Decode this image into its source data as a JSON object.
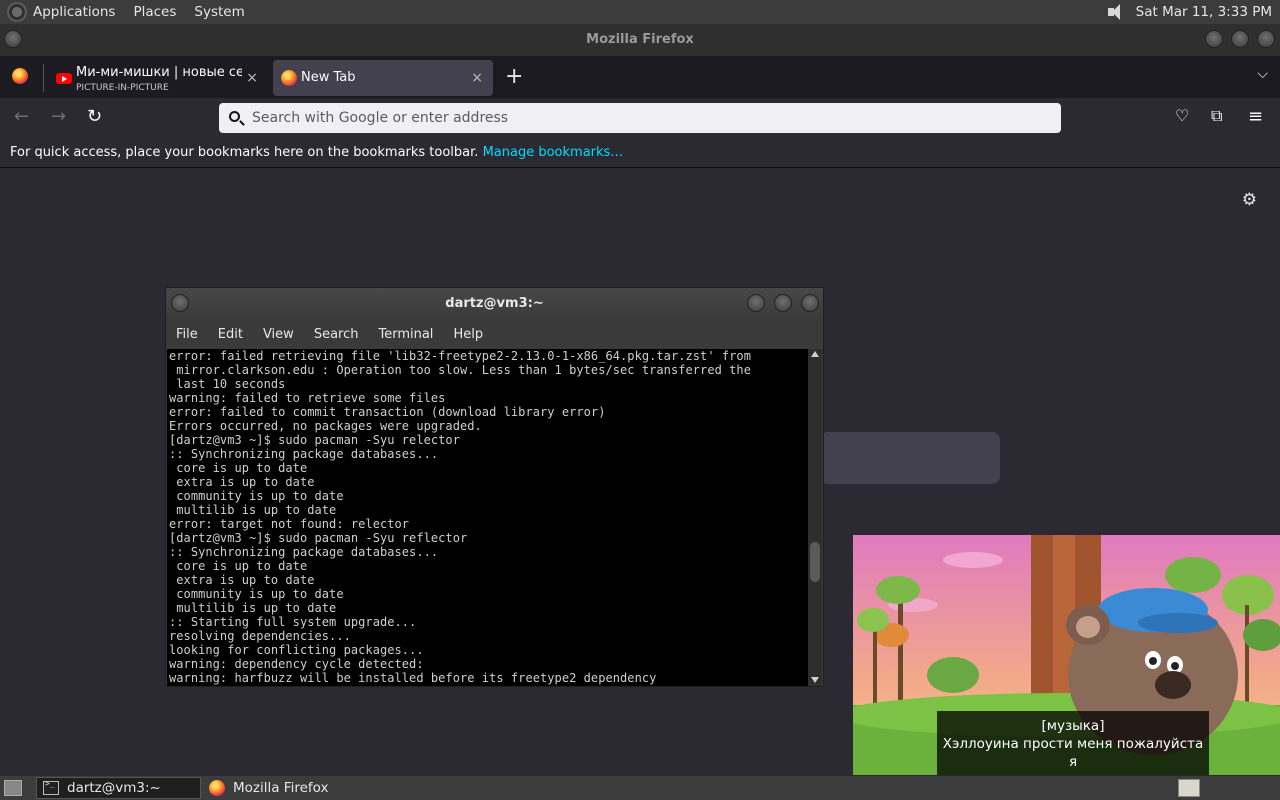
{
  "top_panel": {
    "menus": [
      "Applications",
      "Places",
      "System"
    ],
    "clock": "Sat Mar 11,  3:33 PM"
  },
  "firefox": {
    "window_title": "Mozilla Firefox",
    "tabs": [
      {
        "title": "Ми-ми-мишки | новые серии",
        "subtitle": "PICTURE-IN-PICTURE",
        "close": "×"
      },
      {
        "title": "New Tab",
        "close": "×"
      }
    ],
    "new_tab_label": "+",
    "list_all_tabs_label": "⌵",
    "nav": {
      "back": "←",
      "forward": "→",
      "reload": "↻"
    },
    "urlbar_placeholder": "Search with Google or enter address",
    "toolbar_icons": {
      "pocket": "♡",
      "extensions": "⧉",
      "menu": "≡"
    },
    "bookmarks_toolbar": {
      "text": "For quick access, place your bookmarks here on the bookmarks toolbar.",
      "link": "Manage bookmarks…"
    },
    "settings_icon": "⚙"
  },
  "terminal": {
    "title": "dartz@vm3:~",
    "menus": [
      "File",
      "Edit",
      "View",
      "Search",
      "Terminal",
      "Help"
    ],
    "lines": [
      "error: failed retrieving file 'lib32-freetype2-2.13.0-1-x86_64.pkg.tar.zst' from",
      " mirror.clarkson.edu : Operation too slow. Less than 1 bytes/sec transferred the",
      " last 10 seconds",
      "warning: failed to retrieve some files",
      "error: failed to commit transaction (download library error)",
      "Errors occurred, no packages were upgraded.",
      "[dartz@vm3 ~]$ sudo pacman -Syu relector",
      ":: Synchronizing package databases...",
      " core is up to date",
      " extra is up to date",
      " community is up to date",
      " multilib is up to date",
      "error: target not found: relector",
      "[dartz@vm3 ~]$ sudo pacman -Syu reflector",
      ":: Synchronizing package databases...",
      " core is up to date",
      " extra is up to date",
      " community is up to date",
      " multilib is up to date",
      ":: Starting full system upgrade...",
      "resolving dependencies...",
      "looking for conflicting packages...",
      "warning: dependency cycle detected:",
      "warning: harfbuzz will be installed before its freetype2 dependency"
    ]
  },
  "pip": {
    "caption_line1": "[музыка]",
    "caption_line2": "Хэллоуина прости меня пожалуйста я"
  },
  "taskbar": {
    "items": [
      "dartz@vm3:~",
      "Mozilla Firefox"
    ]
  }
}
